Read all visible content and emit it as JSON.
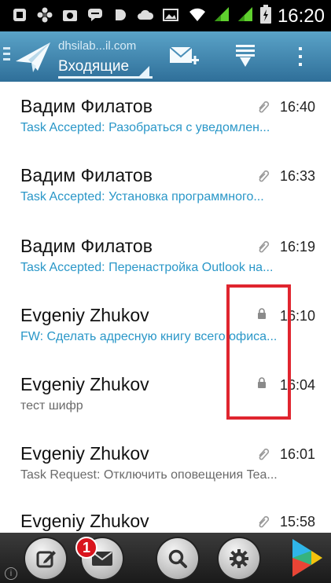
{
  "status_bar": {
    "time": "16:20",
    "icons": [
      "app-icon",
      "flower-icon",
      "camera-icon",
      "chat-icon",
      "d-icon",
      "cloud-icon",
      "image-icon",
      "wifi-icon",
      "signal-icon",
      "signal-icon",
      "battery-icon"
    ]
  },
  "action_bar": {
    "account": "dhsilab...il.com",
    "folder": "Входящие",
    "icons": [
      "menu-icon",
      "send-logo-icon",
      "compose-mail-icon",
      "sync-download-icon",
      "overflow-menu-icon"
    ]
  },
  "messages": [
    {
      "sender": "Вадим Филатов",
      "subject": "Task Accepted: Разобраться с уведомлен...",
      "time": "16:40",
      "icon": "paperclip-icon",
      "subject_color": "#2a97c8"
    },
    {
      "sender": "Вадим Филатов",
      "subject": "Task Accepted: Установка программного...",
      "time": "16:33",
      "icon": "paperclip-icon",
      "subject_color": "#2a97c8"
    },
    {
      "sender": "Вадим Филатов",
      "subject": "Task Accepted: Перенастройка Outlook на...",
      "time": "16:19",
      "icon": "paperclip-icon",
      "subject_color": "#2a97c8"
    },
    {
      "sender": "Evgeniy Zhukov",
      "subject": "FW: Сделать адресную книгу всего офиса...",
      "time": "16:10",
      "icon": "lock-icon",
      "subject_color": "#2a97c8"
    },
    {
      "sender": "Evgeniy Zhukov",
      "subject": "тест шифр",
      "time": "16:04",
      "icon": "lock-icon",
      "subject_color": "#6a6a6a"
    },
    {
      "sender": "Evgeniy Zhukov",
      "subject": "Task Request: Отключить оповещения Tea...",
      "time": "16:01",
      "icon": "paperclip-icon",
      "subject_color": "#6a6a6a"
    },
    {
      "sender": "Evgeniy Zhukov",
      "subject": "",
      "time": "15:58",
      "icon": "paperclip-icon",
      "subject_color": "#6a6a6a"
    }
  ],
  "bottom_bar": {
    "badge_count": "1",
    "info": "i",
    "icons": [
      "compose-icon",
      "mail-icon",
      "search-icon",
      "settings-icon",
      "play-store-icon"
    ]
  },
  "colors": {
    "accent": "#2a97c8",
    "action_bar": "#3f84ad",
    "highlight": "#e0252f"
  }
}
